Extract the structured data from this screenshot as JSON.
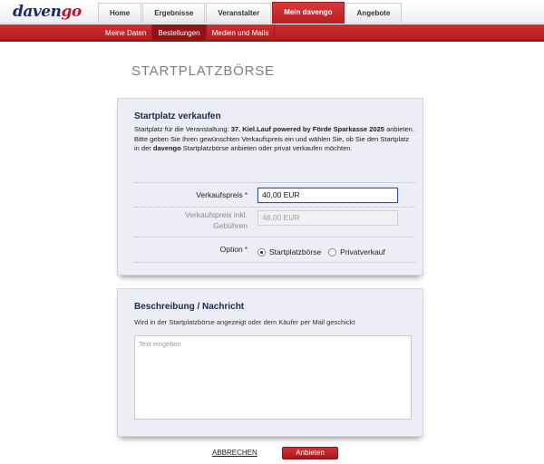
{
  "logo": {
    "part1": "daven",
    "part2": "go"
  },
  "topnav": {
    "tabs": [
      {
        "label": "Home"
      },
      {
        "label": "Ergebnisse"
      },
      {
        "label": "Veranstalter"
      },
      {
        "label": "Mein davengo"
      },
      {
        "label": "Angebote"
      }
    ],
    "active": "Mein davengo"
  },
  "subnav": {
    "tabs": [
      {
        "label": "Meine Daten"
      },
      {
        "label": "Bestellungen"
      },
      {
        "label": "Medien und Mails"
      }
    ],
    "active": "Bestellungen"
  },
  "page": {
    "title": "STARTPLATZBÖRSE"
  },
  "sell": {
    "title": "Startplatz verkaufen",
    "desc_pre": "Startplatz für die Veranstaltung: ",
    "event": "37. Kiel.Lauf powered by Förde Sparkasse 2025",
    "desc_post": " anbieten.",
    "desc2_pre": "Bitte geben Sie Ihren gewünschten Verkaufspreis ein und wählen Sie, ob Sie den Startplatz in der ",
    "brand": "davengo",
    "desc2_post": " Startplatzbörse anbieten oder privat verkaufen möchten.",
    "price_label": "Verkaufspreis",
    "price_required": "*",
    "price_value": "40,00 EUR",
    "price_incl_label_1": "Verkaufspreis inkl.",
    "price_incl_label_2": "Gebühren",
    "price_incl_value": "48,00 EUR",
    "option_label": "Option",
    "option_required": "*",
    "options": [
      {
        "label": "Startplatzbörse",
        "checked": true
      },
      {
        "label": "Privatverkauf",
        "checked": false
      }
    ]
  },
  "message": {
    "title": "Beschreibung / Nachricht",
    "subtitle": "Wird in der Startplatzbörse angezeigt oder dem Käufer per Mail geschickt",
    "placeholder": "Text eingeben"
  },
  "actions": {
    "cancel_label": "ABBRECHEN",
    "submit_label": "Anbieten"
  },
  "colors": {
    "brand_blue": "#1f2a6d",
    "brand_red": "#c8102e",
    "nav_red": "#b31d20",
    "card_bg": "#ecedf5",
    "focus_blue": "#1a55c8"
  }
}
